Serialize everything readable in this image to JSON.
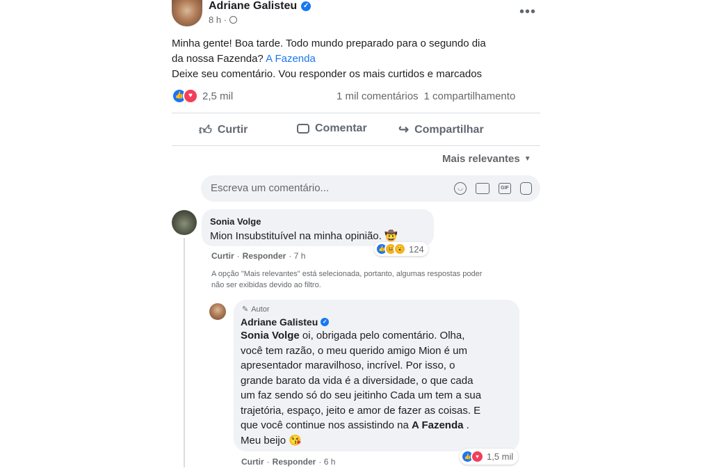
{
  "post": {
    "author": "Adriane Galisteu",
    "time": "8 h ·",
    "more_icon": "more-dots-icon",
    "text_line1": "Minha gente! Boa tarde. Todo mundo preparado para o segundo dia",
    "text_line2_prefix": "da nossa Fazenda?",
    "text_line2_link": "A Fazenda",
    "text_line3": "Deixe seu comentário. Vou responder os mais curtidos e marcados",
    "reactions_count": "2,5 mil",
    "comments_count": "1 mil comentários",
    "shares_count": "1 compartilhamento"
  },
  "actions": {
    "like": "Curtir",
    "comment": "Comentar",
    "share": "Compartilhar"
  },
  "sort": {
    "label": "Mais relevantes"
  },
  "composer": {
    "placeholder": "Escreva um comentário..."
  },
  "comment1": {
    "author": "Sonia Volge",
    "text": "Mion Insubstituível na minha opinião. 🤠",
    "like": "Curtir",
    "reply": "Responder",
    "time": "· 7 h",
    "reactions_count": "124"
  },
  "filter_notice": {
    "line1": "A opção \"Mais relevantes\" está selecionada, portanto, algumas respostas poder",
    "line2": "não ser exibidas devido ao filtro."
  },
  "reply": {
    "badge": "Autor",
    "author": "Adriane Galisteu",
    "mention": "Sonia Volge",
    "line1": " oi, obrigada pelo comentário. Olha,",
    "line2": "você tem razão, o meu querido amigo Mion é um",
    "line3": "apresentador maravilhoso, incrível. Por isso, o",
    "line4": "grande barato da vida é a diversidade, o que cada",
    "line5": "um faz sendo só do seu jeitinho Cada um tem a sua",
    "line6": "trajetória, espaço, jeito e amor de fazer as coisas. E",
    "line7_prefix": "que você continue nos assistindo na ",
    "line7_bold": "A Fazenda",
    "line7_suffix": " .",
    "line8": "Meu beijo 😘",
    "like": "Curtir",
    "reply": "Responder",
    "time": "· 6 h",
    "reactions_count": "1,5 mil"
  },
  "colors": {
    "facebook_blue": "#1877f2",
    "love_red": "#f33e58",
    "haha_yellow": "#f7b125"
  }
}
